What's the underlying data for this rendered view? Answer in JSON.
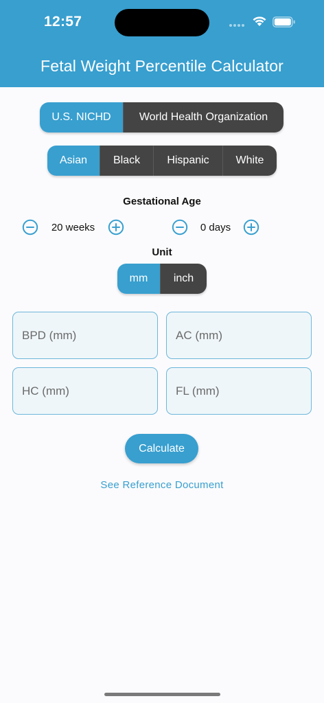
{
  "status_bar": {
    "time": "12:57",
    "icons": [
      "signal-dots-icon",
      "wifi-icon",
      "battery-icon"
    ]
  },
  "header": {
    "title": "Fetal Weight Percentile Calculator",
    "color": "#389fcf"
  },
  "standard_selector": {
    "options": [
      "U.S. NICHD",
      "World Health Organization"
    ],
    "selected": "U.S. NICHD"
  },
  "ethnicity_selector": {
    "options": [
      "Asian",
      "Black",
      "Hispanic",
      "White"
    ],
    "selected": "Asian"
  },
  "gestational_age": {
    "label": "Gestational Age",
    "weeks": "20 weeks",
    "days": "0 days"
  },
  "unit": {
    "label": "Unit",
    "options": [
      "mm",
      "inch"
    ],
    "selected": "mm"
  },
  "fields": {
    "bpd_placeholder": "BPD (mm)",
    "ac_placeholder": "AC (mm)",
    "hc_placeholder": "HC (mm)",
    "fl_placeholder": "FL (mm)"
  },
  "actions": {
    "calculate_label": "Calculate",
    "reference_link": "See Reference Document"
  },
  "colors": {
    "accent": "#389fcf",
    "inactive_segment": "#444444",
    "field_background": "#eff6f9"
  }
}
